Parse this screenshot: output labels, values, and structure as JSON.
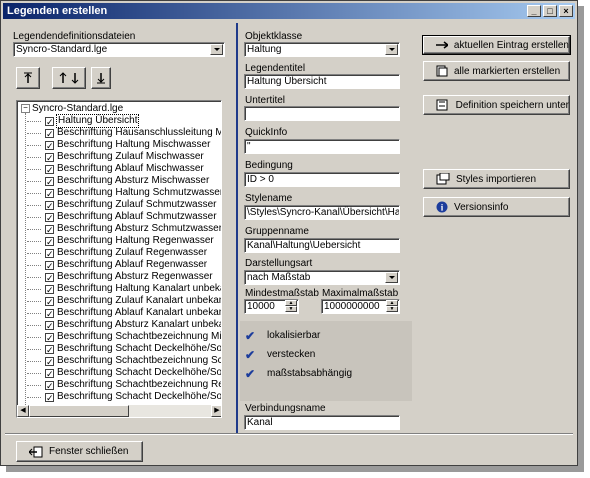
{
  "window": {
    "title": "Legenden erstellen"
  },
  "left": {
    "files_label": "Legendendefinitionsdateien",
    "files_value": "Syncro-Standard.lge",
    "tree_root": "Syncro-Standard.lge",
    "tree_items": [
      "Haltung Übersicht",
      "Beschriftung Hausanschlussleitung Mischw",
      "Beschriftung Haltung Mischwasser",
      "Beschriftung Zulauf Mischwasser",
      "Beschriftung Ablauf Mischwasser",
      "Beschriftung Absturz Mischwasser",
      "Beschriftung Haltung Schmutzwasser",
      "Beschriftung Zulauf Schmutzwasser",
      "Beschriftung Ablauf Schmutzwasser",
      "Beschriftung Absturz Schmutzwasser",
      "Beschriftung Haltung Regenwasser",
      "Beschriftung Zulauf Regenwasser",
      "Beschriftung Ablauf Regenwasser",
      "Beschriftung Absturz Regenwasser",
      "Beschriftung Haltung Kanalart unbekannt",
      "Beschriftung Zulauf Kanalart unbekannt",
      "Beschriftung Ablauf Kanalart unbekannt",
      "Beschriftung Absturz Kanalart unbekannt",
      "Beschriftung Schachtbezeichnung Mischw",
      "Beschriftung Schacht Deckelhöhe/Sohle I",
      "Beschriftung Schachtbezeichnung Schmu",
      "Beschriftung Schacht Deckelhöhe/Sohle !",
      "Beschriftung Schachtbezeichnung Regen",
      "Beschriftung Schacht Deckelhöhe/Sohle I"
    ]
  },
  "middle": {
    "objektklasse_label": "Objektklasse",
    "objektklasse_value": "Haltung",
    "legendentitel_label": "Legendentitel",
    "legendentitel_value": "Haltung Übersicht",
    "untertitel_label": "Untertitel",
    "untertitel_value": "",
    "quickinfo_label": "QuickInfo",
    "quickinfo_value": "\"",
    "bedingung_label": "Bedingung",
    "bedingung_value": "ID > 0",
    "stylename_label": "Stylename",
    "stylename_value": "\\Styles\\Syncro-Kanal\\Übersicht\\Haltung",
    "gruppenname_label": "Gruppenname",
    "gruppenname_value": "Kanal\\Haltung\\Uebersicht",
    "darstellungsart_label": "Darstellungsart",
    "darstellungsart_value": "nach Maßstab",
    "min_label": "Mindestmaßstab",
    "min_value": "10000",
    "max_label": "Maximalmaßstab",
    "max_value": "1000000000",
    "lokalisierbar": "lokalisierbar",
    "verstecken": "verstecken",
    "massstab": "maßstabsabhängig",
    "verbindung_label": "Verbindungsname",
    "verbindung_value": "Kanal"
  },
  "right": {
    "btn_current": "aktuellen Eintrag erstellen",
    "btn_all": "alle markierten erstellen",
    "btn_save": "Definition speichern unter",
    "btn_styles": "Styles importieren",
    "btn_version": "Versionsinfo"
  },
  "footer": {
    "close": "Fenster schließen"
  },
  "colors": {
    "accent": "#0a246a",
    "divider": "#1f3a8a"
  }
}
